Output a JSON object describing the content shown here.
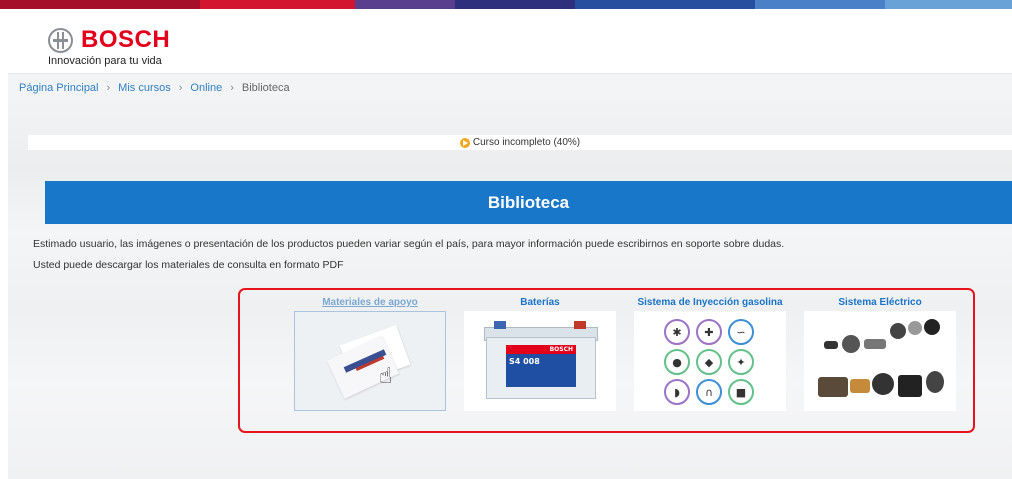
{
  "header": {
    "brand": "BOSCH",
    "tagline": "Innovación para tu vida",
    "band_colors": [
      "#b5102a",
      "#d4112e",
      "#5a3f8f",
      "#3c3c8c",
      "#2d5db3",
      "#4a7fc8",
      "#5f9ad3"
    ]
  },
  "breadcrumb": {
    "items": [
      "Página Principal",
      "Mis cursos",
      "Online"
    ],
    "current": "Biblioteca",
    "separator": "›"
  },
  "progress": {
    "label": "Curso incompleto (40%)",
    "percent": 40,
    "icon": "play-circle-icon"
  },
  "banner": {
    "title": "Biblioteca"
  },
  "intro": {
    "line1": "Estimado usuario, las imágenes o presentación de los productos pueden variar según el país, para mayor información puede escribirnos en soporte sobre dudas.",
    "line2": "Usted puede descargar los materiales de consulta en formato PDF"
  },
  "categories": [
    {
      "title": "Materiales de apoyo",
      "image": "documents-image",
      "selected": true
    },
    {
      "title": "Baterías",
      "image": "battery-image",
      "battery_text": "S4 008"
    },
    {
      "title": "Sistema de Inyección gasolina",
      "image": "sensors-image"
    },
    {
      "title": "Sistema Eléctrico",
      "image": "starter-motor-parts-image"
    }
  ]
}
